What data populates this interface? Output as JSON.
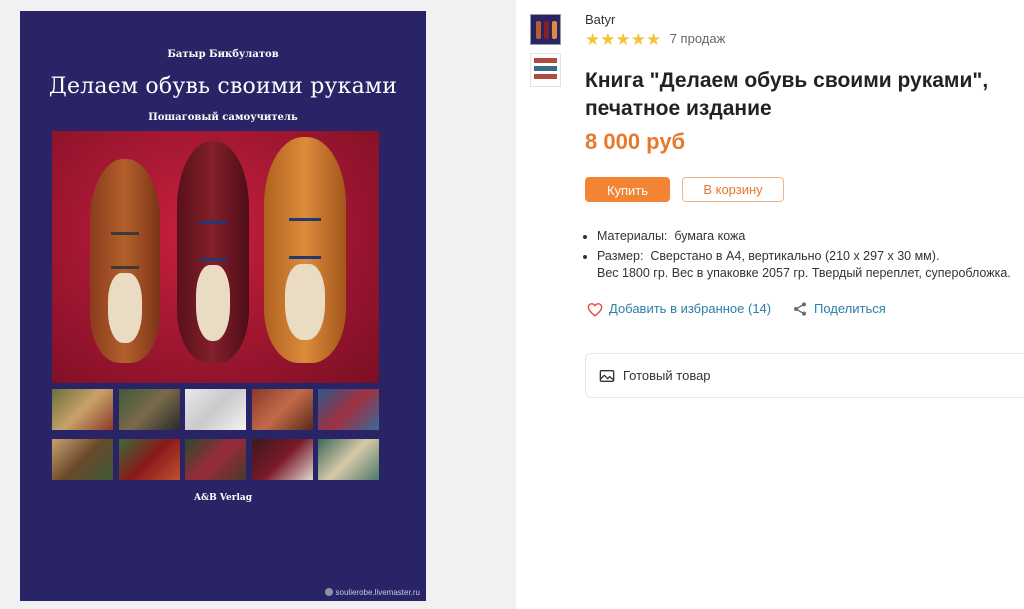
{
  "gallery": {
    "cover": {
      "author": "Батыр Бикбулатов",
      "title": "Делаем обувь своими руками",
      "subtitle": "Пошаговый самоучитель",
      "publisher": "A&B Verlag",
      "watermark": "soulierobe.livemaster.ru"
    }
  },
  "product": {
    "seller": "Batyr",
    "rating_stars": 5,
    "sales": "7 продаж",
    "title": "Книга \"Делаем обувь своими руками\", печатное издание",
    "price": "8 000 руб",
    "buy_label": "Купить",
    "cart_label": "В корзину",
    "specs": [
      {
        "key": "Материалы:",
        "value": "бумага кожа"
      },
      {
        "key": "Размер:",
        "value": "Сверстано в А4, вертикально (210 х 297 х 30 мм).",
        "value2": "Вес 1800 гр. Вес в упаковке 2057 гр. Твердый переплет, суперобложка."
      }
    ],
    "favorite_label": "Добавить в избранное (14)",
    "share_label": "Поделиться",
    "ready_label": "Готовый товар"
  },
  "colors": {
    "accent": "#f28434",
    "price": "#e8782d",
    "link": "#2b7ea8",
    "star": "#f6c43a",
    "cover_bg": "#282466"
  },
  "icons": {
    "star": "star-icon",
    "heart": "heart-icon",
    "share": "share-icon",
    "image": "image-icon"
  }
}
